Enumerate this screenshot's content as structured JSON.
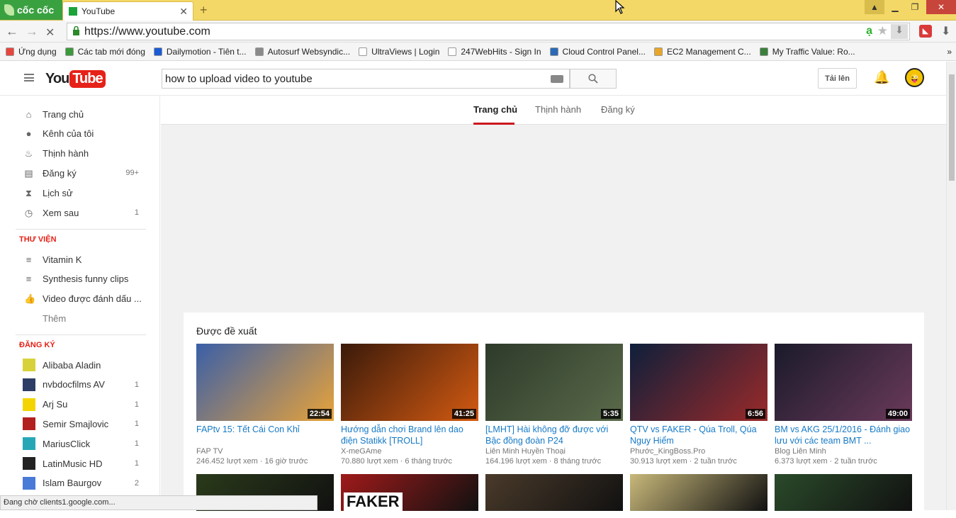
{
  "browser": {
    "brand": "cốc cốc",
    "tab_title": "YouTube",
    "url": "https://www.youtube.com",
    "status": "Đang chờ clients1.google.com..."
  },
  "bookmarks": [
    {
      "label": "Ứng dụng",
      "icon": "apps-grid-icon",
      "color": "#e8453c"
    },
    {
      "label": "Các tab mới đóng",
      "icon": "history-icon",
      "color": "#3a9a3a"
    },
    {
      "label": "Dailymotion - Tiên t...",
      "icon": "dailymotion-icon",
      "color": "#1a5bd6"
    },
    {
      "label": "Autosurf Websyndic...",
      "icon": "w-icon",
      "color": "#8a8a8a"
    },
    {
      "label": "UltraViews | Login",
      "icon": "page-icon",
      "color": "#ffffff"
    },
    {
      "label": "247WebHits - Sign In",
      "icon": "page-icon",
      "color": "#ffffff"
    },
    {
      "label": "Cloud Control Panel...",
      "icon": "cloud-icon",
      "color": "#2a6ab7"
    },
    {
      "label": "EC2 Management C...",
      "icon": "box-icon",
      "color": "#e8a628"
    },
    {
      "label": "My Traffic Value: Ro...",
      "icon": "globe-icon",
      "color": "#3b7f3b"
    }
  ],
  "header": {
    "logo_you": "You",
    "logo_tube": "Tube",
    "search_value": "how to upload video to youtube",
    "upload_label": "Tải lên"
  },
  "sidebar": {
    "main_items": [
      {
        "label": "Trang chủ",
        "count": "",
        "icon": "home-icon"
      },
      {
        "label": "Kênh của tôi",
        "count": "",
        "icon": "account-icon"
      },
      {
        "label": "Thịnh hành",
        "count": "",
        "icon": "flame-icon"
      },
      {
        "label": "Đăng ký",
        "count": "99+",
        "icon": "subscriptions-icon"
      },
      {
        "label": "Lịch sử",
        "count": "",
        "icon": "hourglass-icon"
      },
      {
        "label": "Xem sau",
        "count": "1",
        "icon": "clock-icon"
      }
    ],
    "library_title": "THƯ VIỆN",
    "library_items": [
      {
        "label": "Vitamin K",
        "icon": "playlist-icon"
      },
      {
        "label": "Synthesis funny clips",
        "icon": "playlist-icon"
      },
      {
        "label": "Video được đánh dấu ...",
        "icon": "thumbs-up-icon"
      },
      {
        "label": "Thêm",
        "icon": ""
      }
    ],
    "subs_title": "ĐĂNG KÝ",
    "subscriptions": [
      {
        "label": "Alibaba Aladin",
        "count": "",
        "color": "#d8d23a"
      },
      {
        "label": "nvbdocfilms AV",
        "count": "1",
        "color": "#2c3e66"
      },
      {
        "label": "Arj Su",
        "count": "1",
        "color": "#f3d400"
      },
      {
        "label": "Semir Smajlovic",
        "count": "1",
        "color": "#b22020"
      },
      {
        "label": "MariusClick",
        "count": "1",
        "color": "#27a7b5"
      },
      {
        "label": "LatinMusic HD",
        "count": "1",
        "color": "#222222"
      },
      {
        "label": "Islam Baurgov",
        "count": "2",
        "color": "#4a7ad8"
      }
    ]
  },
  "main": {
    "tabs": [
      "Trang chủ",
      "Thịnh hành",
      "Đăng ký"
    ],
    "section_title": "Được đề xuất",
    "videos": [
      {
        "title": "FAPtv 15: Tết Cái Con Khỉ",
        "channel": "FAP TV",
        "views": "246.452 lượt xem",
        "age": "16 giờ trước",
        "duration": "22:54",
        "c1": "#3a5fa8",
        "c2": "#e8a33a"
      },
      {
        "title": "Hướng dẫn chơi Brand lên dao điện Statikk [TROLL]",
        "channel": "X-meGAme",
        "views": "70.880 lượt xem",
        "age": "6 tháng trước",
        "duration": "41:25",
        "c1": "#3a1a0a",
        "c2": "#d35a12"
      },
      {
        "title": "[LMHT] Hài không đỡ được với Bậc đồng đoàn P24",
        "channel": "Liên Minh Huyền Thoại",
        "views": "164.196 lượt xem",
        "age": "8 tháng trước",
        "duration": "5:35",
        "c1": "#2d3a2a",
        "c2": "#5a6a4a"
      },
      {
        "title": "QTV vs FAKER - Qúa Troll, Qúa Nguy Hiểm",
        "channel": "Phước_KingBoss.Pro",
        "views": "30.913 lượt xem",
        "age": "2 tuần trước",
        "duration": "6:56",
        "c1": "#0e1f3a",
        "c2": "#9a2a2a"
      },
      {
        "title": "BM vs AKG 25/1/2016 - Đánh giao lưu với các team BMT ...",
        "channel": "Blog Liên Minh",
        "views": "6.373 lượt xem",
        "age": "2 tuần trước",
        "duration": "49:00",
        "c1": "#1a1a2a",
        "c2": "#6a3a5a"
      }
    ],
    "row2_colors": [
      "#2a3a1a",
      "#a01a1a",
      "#4a3a2a",
      "#c8b87a",
      "#2a4a2a"
    ],
    "row2_text": "FAKER"
  },
  "colors": {
    "brand_red": "#e62117",
    "link_blue": "#167ac6",
    "tab_accent": "#cc181e",
    "browser_yellow": "#f4d867"
  }
}
